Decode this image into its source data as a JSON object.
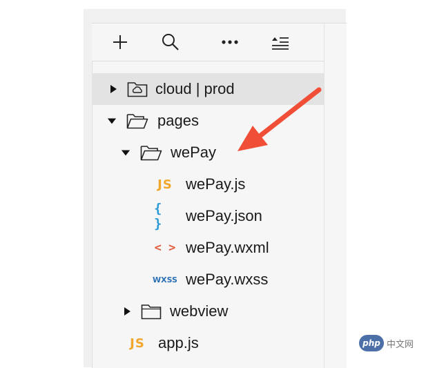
{
  "toolbar": {
    "buttons": [
      {
        "icon": "plus-icon"
      },
      {
        "icon": "search-icon"
      },
      {
        "icon": "more-icon"
      },
      {
        "icon": "collapse-icon"
      }
    ]
  },
  "tree": [
    {
      "label": "cloud | prod",
      "kind": "cloud-folder",
      "expanded": false,
      "selected": true
    },
    {
      "label": "pages",
      "kind": "folder",
      "expanded": true
    },
    {
      "label": "wePay",
      "kind": "folder",
      "expanded": true
    },
    {
      "label": "wePay.js",
      "kind": "js",
      "badge": "JS"
    },
    {
      "label": "wePay.json",
      "kind": "json",
      "badge": "{ }"
    },
    {
      "label": "wePay.wxml",
      "kind": "wxml",
      "badge": "< >"
    },
    {
      "label": "wePay.wxss",
      "kind": "wxss",
      "badge": "WXSS"
    },
    {
      "label": "webview",
      "kind": "folder",
      "expanded": false
    },
    {
      "label": "app.js",
      "kind": "js",
      "badge": "JS"
    }
  ],
  "colors": {
    "js": "#f0a72c",
    "json": "#2d9ad8",
    "wxml": "#e25c3d",
    "wxss": "#2a6fb5",
    "arrow": "#f04e37"
  },
  "watermark": {
    "badge": "php",
    "text": "中文网"
  }
}
